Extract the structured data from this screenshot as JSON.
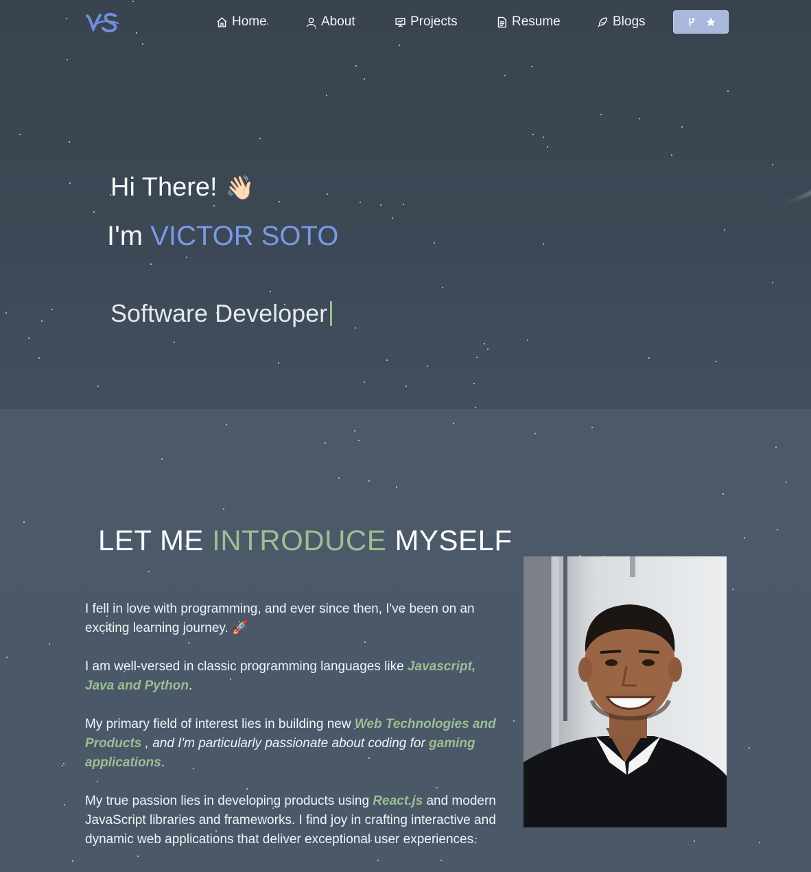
{
  "nav": {
    "logo_text": "VS",
    "items": [
      {
        "label": "Home",
        "icon": "home-icon"
      },
      {
        "label": "About",
        "icon": "user-icon"
      },
      {
        "label": "Projects",
        "icon": "presentation-icon"
      },
      {
        "label": "Resume",
        "icon": "document-icon"
      },
      {
        "label": "Blogs",
        "icon": "feather-icon"
      }
    ],
    "star_button": {
      "icons": [
        "git-branch-icon",
        "star-icon"
      ]
    }
  },
  "hero": {
    "greeting": "Hi There!",
    "wave_emoji": "👋🏻",
    "im_prefix": "I'm ",
    "name": "VICTOR SOTO",
    "role": "Software Developer"
  },
  "intro": {
    "title_before": "LET ME ",
    "title_accent": "INTRODUCE",
    "title_after": " MYSELF",
    "p1_text": "I fell in love with programming, and ever since then, I've been on an exciting learning journey. 🚀",
    "p2_text": "I am well-versed in classic programming languages like ",
    "p2_highlight": "Javascript, Java and Python",
    "p2_end": ".",
    "p3_text": "My primary field of interest lies in building new ",
    "p3_highlight1": "Web Technologies and Products",
    "p3_middle": " , and I'm particularly passionate about coding for ",
    "p3_highlight2": "gaming applications",
    "p3_end": ".",
    "p4_text": "My true passion lies in developing products using ",
    "p4_highlight": "React.js",
    "p4_rest": " and modern JavaScript libraries and frameworks. I find joy in crafting interactive and dynamic web applications that deliver exceptional user experiences."
  },
  "colors": {
    "accent_blue": "#7a99e6",
    "accent_green": "#9cbf93",
    "star_button_bg": "#a8b9dd"
  }
}
